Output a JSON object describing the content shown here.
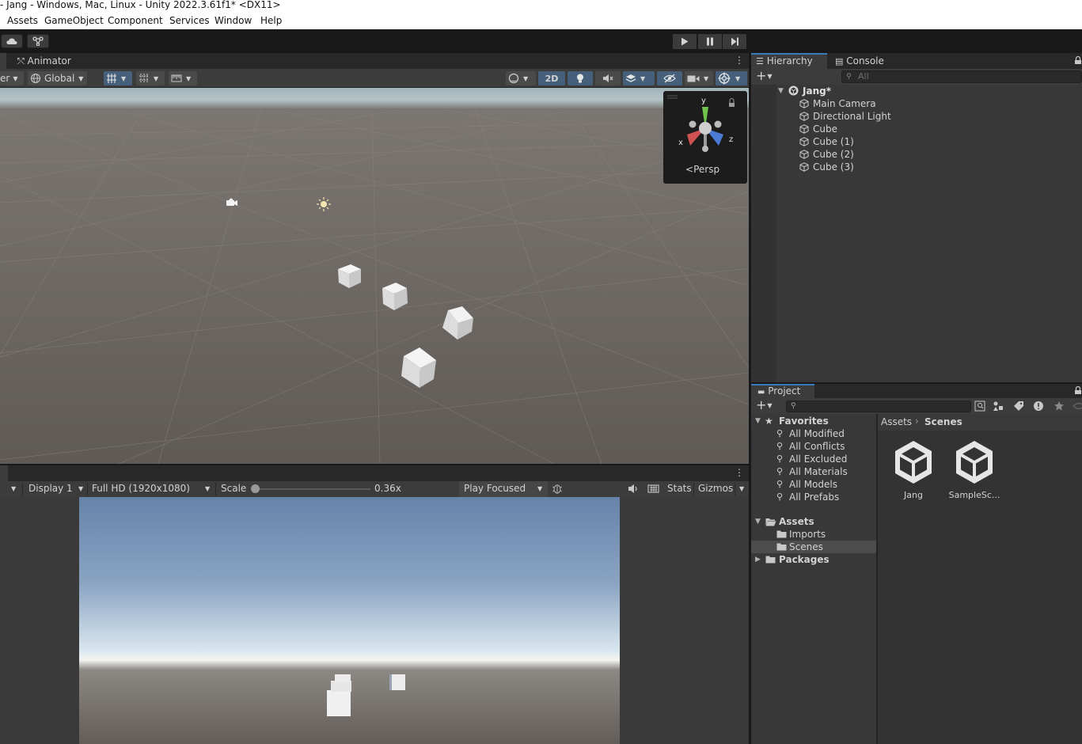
{
  "window": {
    "title": "- Jang - Windows, Mac, Linux - Unity 2022.3.61f1* <DX11>"
  },
  "menu": {
    "items": [
      "Assets",
      "GameObject",
      "Component",
      "Services",
      "Window",
      "Help"
    ]
  },
  "scene": {
    "tab_label": "Animator",
    "tools": {
      "pivot_label": "er",
      "global_label": "Global",
      "two_d_label": "2D"
    },
    "gizmo": {
      "y": "y",
      "x": "x",
      "z": "z",
      "persp_label": "Persp"
    }
  },
  "game": {
    "display_label": "Display 1",
    "resolution_label": "Full HD (1920x1080)",
    "scale_label": "Scale",
    "scale_value": "0.36x",
    "scale_fraction": 0.0,
    "play_mode_label": "Play Focused",
    "stats_label": "Stats",
    "gizmos_label": "Gizmos"
  },
  "hierarchy": {
    "tab_label": "Hierarchy",
    "console_tab_label": "Console",
    "search_placeholder": "All",
    "scene_name": "Jang*",
    "objects": [
      "Main Camera",
      "Directional Light",
      "Cube",
      "Cube (1)",
      "Cube (2)",
      "Cube (3)"
    ]
  },
  "project": {
    "tab_label": "Project",
    "favorites_label": "Favorites",
    "favorites": [
      "All Modified",
      "All Conflicts",
      "All Excluded",
      "All Materials",
      "All Models",
      "All Prefabs"
    ],
    "assets_label": "Assets",
    "asset_folders": [
      "Imports",
      "Scenes"
    ],
    "packages_label": "Packages",
    "breadcrumb": [
      "Assets",
      "Scenes"
    ],
    "files": [
      "Jang",
      "SampleSc..."
    ]
  },
  "colors": {
    "accent": "#3a79bb",
    "selected_row": "#4d4d4d",
    "panel": "#383838"
  }
}
